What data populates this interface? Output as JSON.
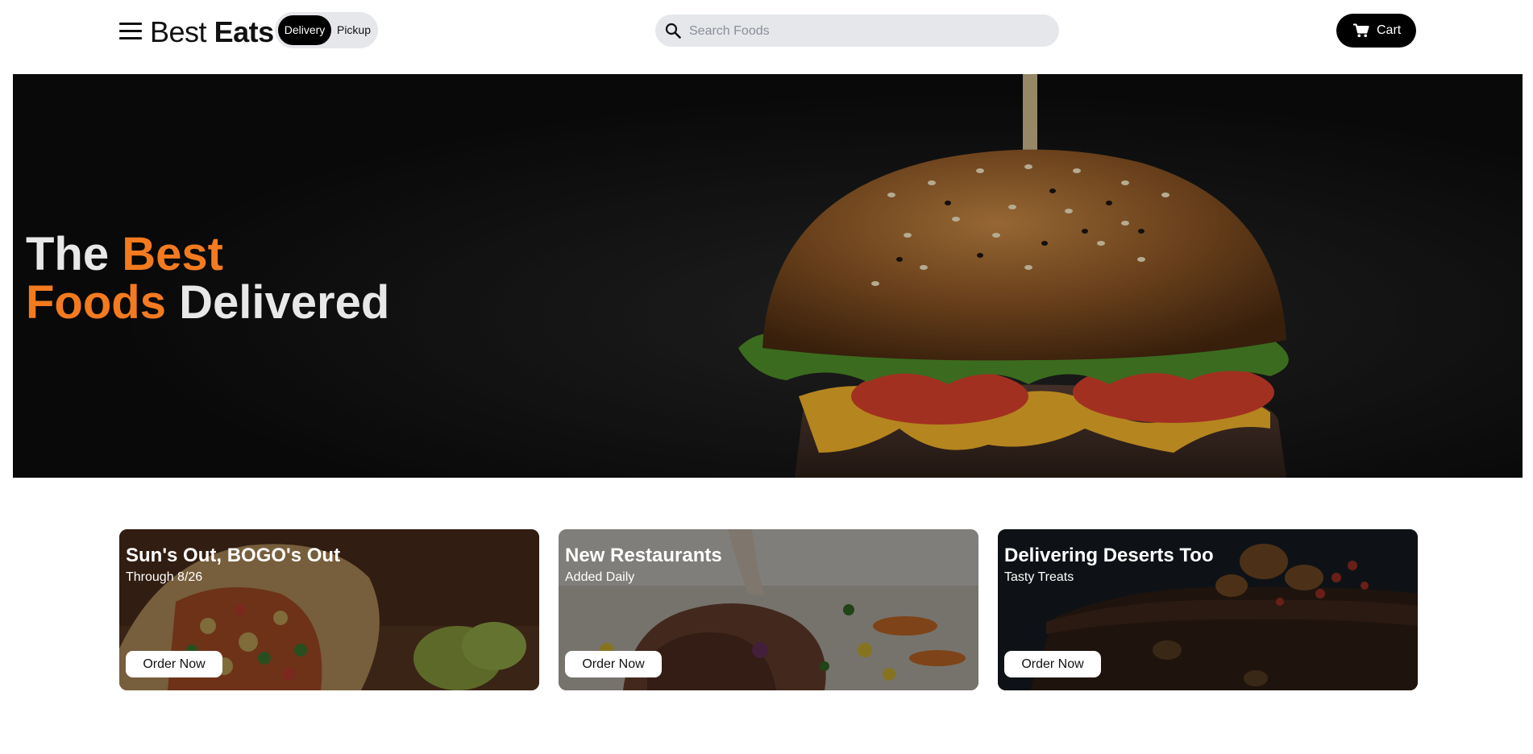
{
  "header": {
    "brand_part1": "Best",
    "brand_part2": "Eats",
    "mode_active": "Delivery",
    "mode_inactive": "Pickup",
    "search_placeholder": "Search Foods",
    "search_value": "",
    "cart_label": "Cart",
    "icons": [
      "menu-icon",
      "search-icon",
      "cart-icon"
    ]
  },
  "hero": {
    "line1_white": "The",
    "line1_accent": "Best",
    "line2_accent": "Foods",
    "line2_white": "Delivered",
    "image": "burger-photo"
  },
  "promos": [
    {
      "title": "Sun's Out, BOGO's Out",
      "subtitle": "Through 8/26",
      "button": "Order Now",
      "image": "burrito-photo"
    },
    {
      "title": "New Restaurants",
      "subtitle": "Added Daily",
      "button": "Order Now",
      "image": "lamb-chops-photo"
    },
    {
      "title": "Delivering Deserts Too",
      "subtitle": "Tasty Treats",
      "button": "Order Now",
      "image": "chocolate-cake-photo"
    }
  ],
  "colors": {
    "accent": "#f37a1f",
    "dark": "#000000",
    "pill": "#e5e7eb",
    "hero_bg": "#121212"
  }
}
